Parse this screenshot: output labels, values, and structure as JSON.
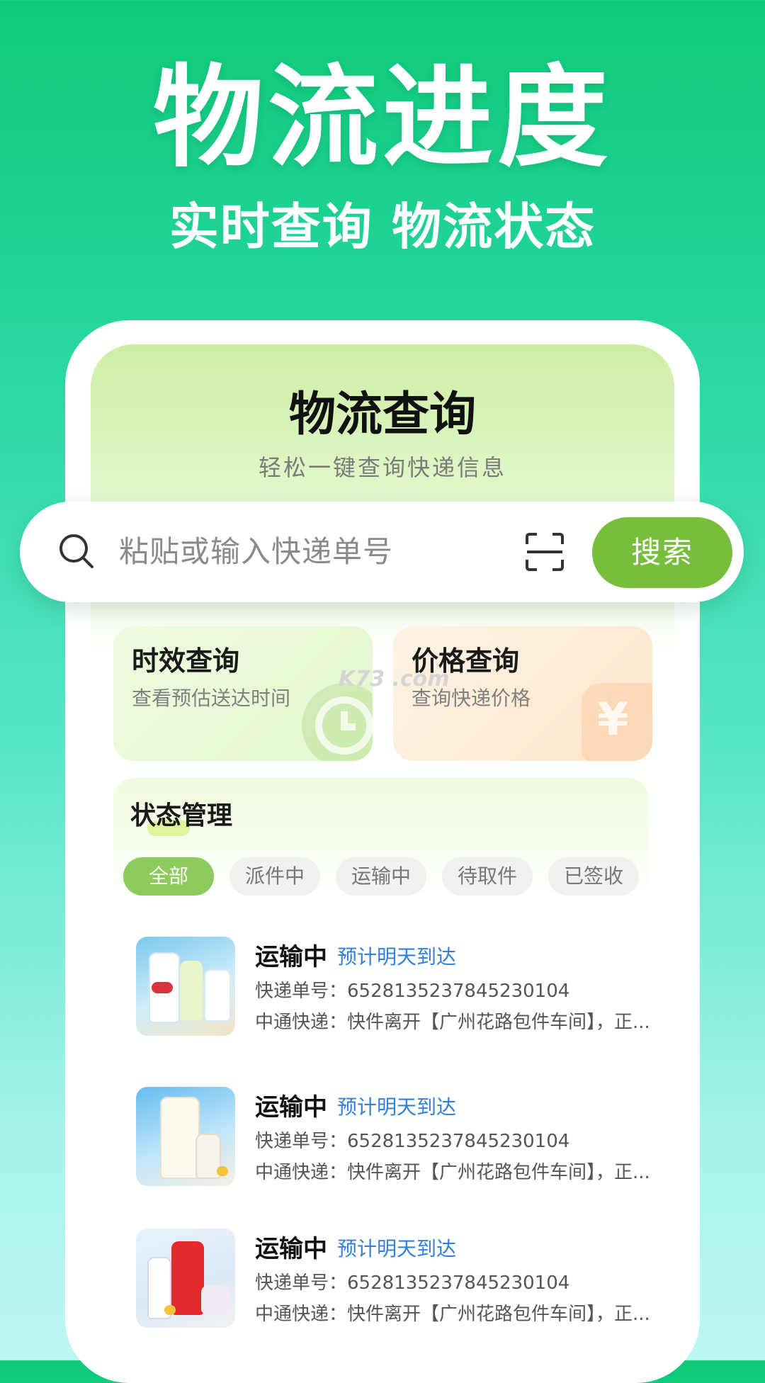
{
  "hero": {
    "title": "物流进度",
    "subtitle": "实时查询 物流状态"
  },
  "screen": {
    "title": "物流查询",
    "subtitle": "轻松一键查询快递信息"
  },
  "search": {
    "placeholder": "粘贴或输入快递单号",
    "button_label": "搜索",
    "search_icon": "search-icon",
    "scan_icon": "scan-icon"
  },
  "cards": [
    {
      "title": "时效查询",
      "desc": "查看预估送达时间",
      "icon": "clock-icon"
    },
    {
      "title": "价格查询",
      "desc": "查询快递价格",
      "icon": "yen-icon"
    }
  ],
  "watermark": "K73 .com",
  "status": {
    "title": "状态管理",
    "tabs": [
      {
        "label": "全部",
        "active": true
      },
      {
        "label": "派件中",
        "active": false
      },
      {
        "label": "运输中",
        "active": false
      },
      {
        "label": "待取件",
        "active": false
      },
      {
        "label": "已签收",
        "active": false
      }
    ]
  },
  "shipments": [
    {
      "status": "运输中",
      "eta": "预计明天到达",
      "number": "快递单号：6528135237845230104",
      "track": "中通快递：快件离开【广州花路包件车间】，正..."
    },
    {
      "status": "运输中",
      "eta": "预计明天到达",
      "number": "快递单号：6528135237845230104",
      "track": "中通快递：快件离开【广州花路包件车间】，正..."
    },
    {
      "status": "运输中",
      "eta": "预计明天到达",
      "number": "快递单号：6528135237845230104",
      "track": "中通快递：快件离开【广州花路包件车间】，正..."
    }
  ],
  "colors": {
    "accent": "#76be3c",
    "eta_blue": "#2f7fe0",
    "hero_green": "#0fca7a"
  }
}
